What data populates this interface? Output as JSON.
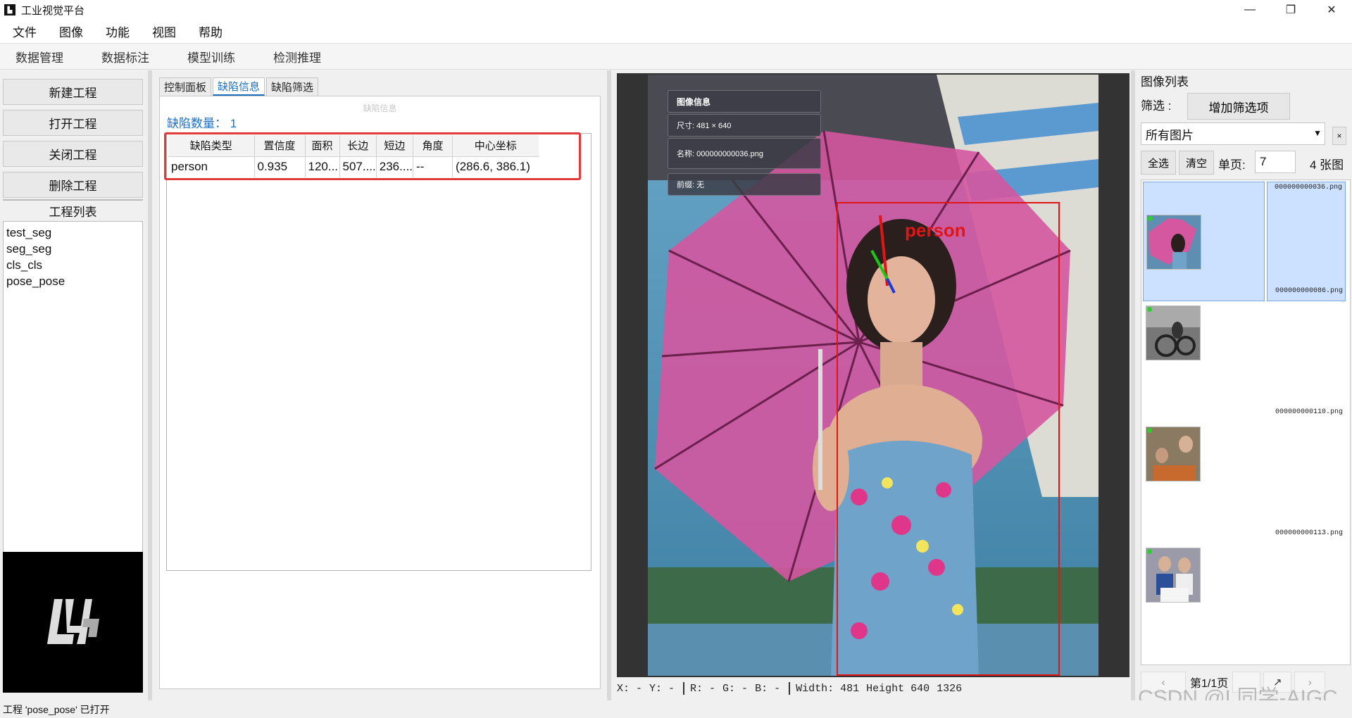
{
  "window": {
    "title": "工业视觉平台",
    "controls": [
      "—",
      "❐",
      "✕"
    ]
  },
  "menu": [
    "文件",
    "图像",
    "功能",
    "视图",
    "帮助"
  ],
  "nav_tabs": [
    "数据管理",
    "数据标注",
    "模型训练",
    "检测推理"
  ],
  "project": {
    "buttons": [
      "新建工程",
      "打开工程",
      "关闭工程",
      "删除工程"
    ],
    "list_title": "工程列表",
    "items": [
      "test_seg",
      "seg_seg",
      "cls_cls",
      "pose_pose"
    ]
  },
  "panel_tabs": [
    "控制面板",
    "缺陷信息",
    "缺陷筛选"
  ],
  "active_tab": "缺陷信息",
  "faint_label": "缺陷信息",
  "defect_count": "缺陷数量： 1",
  "defect_table": {
    "headers": [
      "缺陷类型",
      "置信度",
      "面积",
      "长边",
      "短边",
      "角度",
      "中心坐标"
    ],
    "rows": [
      [
        "person",
        "0.935",
        "120...",
        "507....",
        "236....",
        "--",
        "(286.6, 386.1)"
      ]
    ]
  },
  "image_info": {
    "title": "图像信息",
    "size": "尺寸: 481 × 640",
    "name": "名称: 000000000036.png",
    "prefix": "前缀: 无"
  },
  "detection_label": "person",
  "image_status": {
    "x": "X:    -",
    "y": "Y:    -",
    "r": "R:    -",
    "g": "G:    -",
    "b": "B:    -",
    "width": "Width:  481",
    "height": "Height   640",
    "extra": "1326"
  },
  "image_list": {
    "title": "图像列表",
    "filter_label": "筛选 :",
    "add_filter": "增加筛选项",
    "select_value": "所有图片",
    "clear_x": "×",
    "select_all": "全选",
    "clear": "清空",
    "per_page_label": "单页:",
    "per_page_value": "7",
    "count": "4  张图",
    "files": [
      "000000000036.png",
      "000000000086.png",
      "000000000110.png",
      "000000000113.png"
    ],
    "page_text": "第1/1页"
  },
  "status_message": "工程 'pose_pose' 已打开",
  "watermark": "CSDN @L同学-AIGC",
  "colors": {
    "accent": "#1f6fbf",
    "highlight_red": "#e23a3a",
    "bbox_red": "#e01515"
  }
}
